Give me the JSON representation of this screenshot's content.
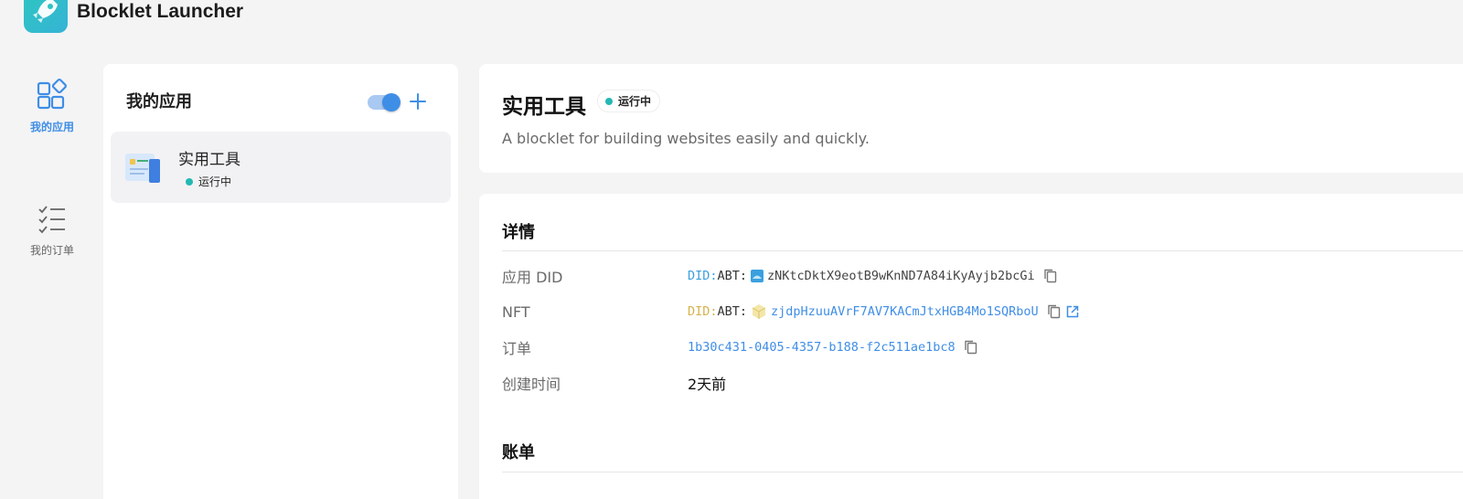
{
  "header": {
    "title": "Blocklet Launcher"
  },
  "nav": {
    "items": [
      {
        "label": "我的应用",
        "icon": "apps-icon",
        "active": true
      },
      {
        "label": "我的订单",
        "icon": "checklist-icon",
        "active": false
      }
    ]
  },
  "apps_panel": {
    "title": "我的应用",
    "toggle_on": true,
    "apps": [
      {
        "name": "实用工具",
        "status": "运行中"
      }
    ]
  },
  "app_info": {
    "name": "实用工具",
    "status": "运行中",
    "description": "A blocklet for building websites easily and quickly."
  },
  "details": {
    "title": "详情",
    "rows": {
      "app_did": {
        "label": "应用 DID",
        "prefix": "DID:",
        "abt": "ABT:",
        "value": "zNKtcDktX9eotB9wKnND7A84iKyAyjb2bcGi"
      },
      "nft": {
        "label": "NFT",
        "prefix": "DID:",
        "abt": "ABT:",
        "value": "zjdpHzuuAVrF7AV7KACmJtxHGB4Mo1SQRboU"
      },
      "order": {
        "label": "订单",
        "value": "1b30c431-0405-4357-b188-f2c511ae1bc8"
      },
      "created": {
        "label": "创建时间",
        "value": "2天前"
      }
    }
  },
  "billing": {
    "title": "账单"
  },
  "colors": {
    "accent": "#3f8ee6",
    "status_running": "#24b8b3",
    "did_blue": "#3aa0df",
    "did_gold": "#d6b24a"
  }
}
